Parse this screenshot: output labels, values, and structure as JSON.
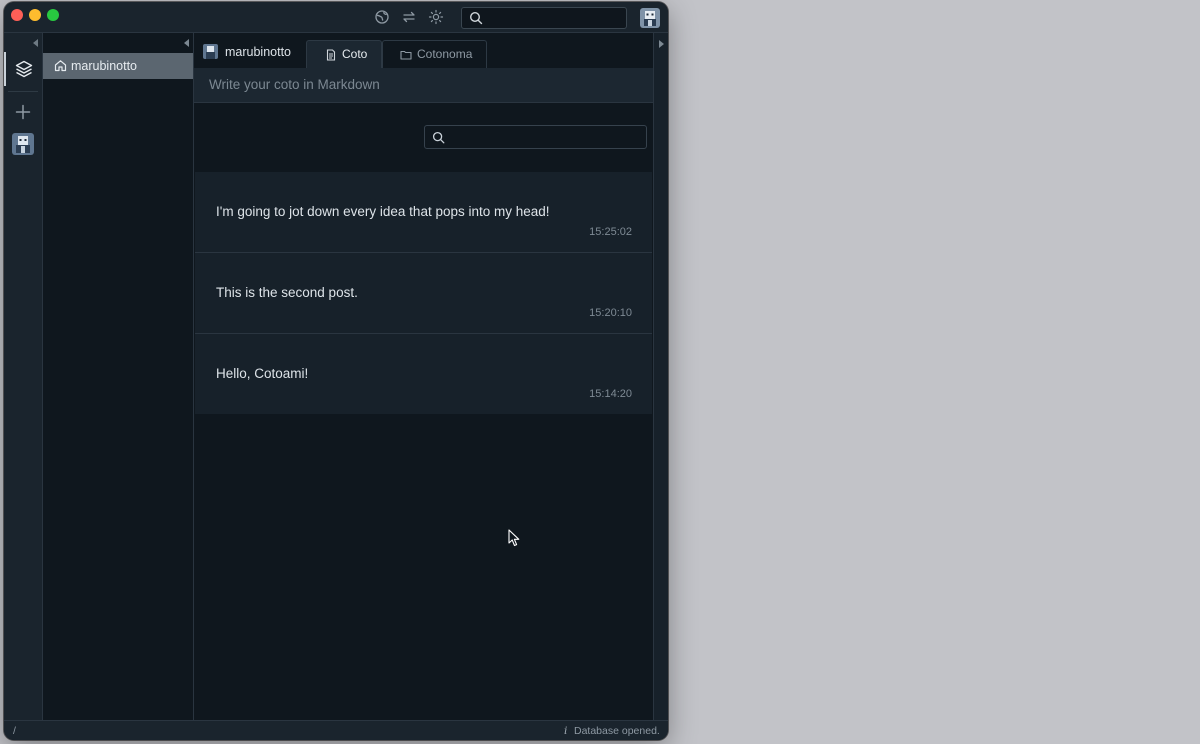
{
  "titlebar": {
    "icons": [
      "globe-icon",
      "swap-icon",
      "sun-icon"
    ],
    "search": {
      "placeholder": ""
    },
    "avatar": "user-avatar"
  },
  "iconbar": {
    "items": [
      "layers-icon",
      "plus-icon",
      "user-avatar"
    ]
  },
  "nav": {
    "items": [
      {
        "label": "marubinotto",
        "icon": "home-icon",
        "selected": true
      }
    ]
  },
  "main": {
    "user_name": "marubinotto",
    "tabs": [
      {
        "label": "Coto",
        "icon": "document-icon",
        "active": true
      },
      {
        "label": "Cotonoma",
        "icon": "folder-icon",
        "active": false
      }
    ],
    "editor_placeholder": "Write your coto in Markdown",
    "filter_placeholder": "",
    "posts": [
      {
        "text": "I'm going to jot down every idea that pops into my head!",
        "time": "15:25:02"
      },
      {
        "text": "This is the second post.",
        "time": "15:20:10"
      },
      {
        "text": "Hello, Cotoami!",
        "time": "15:14:20"
      }
    ]
  },
  "status": {
    "path": "/",
    "info_icon": "i",
    "message": "Database opened."
  },
  "colors": {
    "background": "#c2c3c8",
    "window": "#101820",
    "selected_nav": "#5b6670",
    "traffic_red": "#fe5f57",
    "traffic_yellow": "#febc2e",
    "traffic_green": "#28c840"
  }
}
